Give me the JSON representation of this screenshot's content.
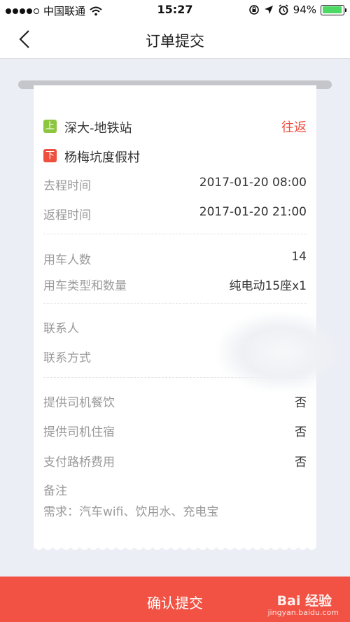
{
  "status_bar": {
    "carrier": "中国联通",
    "time": "15:27",
    "battery_percent": "94%",
    "battery_level": 0.94
  },
  "nav": {
    "title": "订单提交"
  },
  "trip": {
    "boarding_tag": "上",
    "boarding_stop": "深大-地铁站",
    "alighting_tag": "下",
    "alighting_stop": "杨梅坑度假村",
    "trip_type": "往返",
    "departure_label": "去程时间",
    "departure_value": "2017-01-20 08:00",
    "return_label": "返程时间",
    "return_value": "2017-01-20 21:00"
  },
  "vehicle": {
    "passengers_label": "用车人数",
    "passengers_value": "14",
    "type_label": "用车类型和数量",
    "type_value": "纯电动15座x1"
  },
  "contact": {
    "name_label": "联系人",
    "phone_label": "联系方式"
  },
  "services": {
    "meals_label": "提供司机餐饮",
    "meals_value": "否",
    "lodging_label": "提供司机住宿",
    "lodging_value": "否",
    "tolls_label": "支付路桥费用",
    "tolls_value": "否"
  },
  "remarks": {
    "label": "备注",
    "text": "需求：汽车wifi、饮用水、充电宝"
  },
  "footer": {
    "submit_label": "确认提交",
    "watermark": "Bai 经验",
    "watermark_url": "jingyan.baidu.com"
  },
  "colors": {
    "accent": "#f15243",
    "boarding_tag": "#8cc63f",
    "alighting_tag": "#ef4f3f",
    "background": "#eceef6"
  }
}
